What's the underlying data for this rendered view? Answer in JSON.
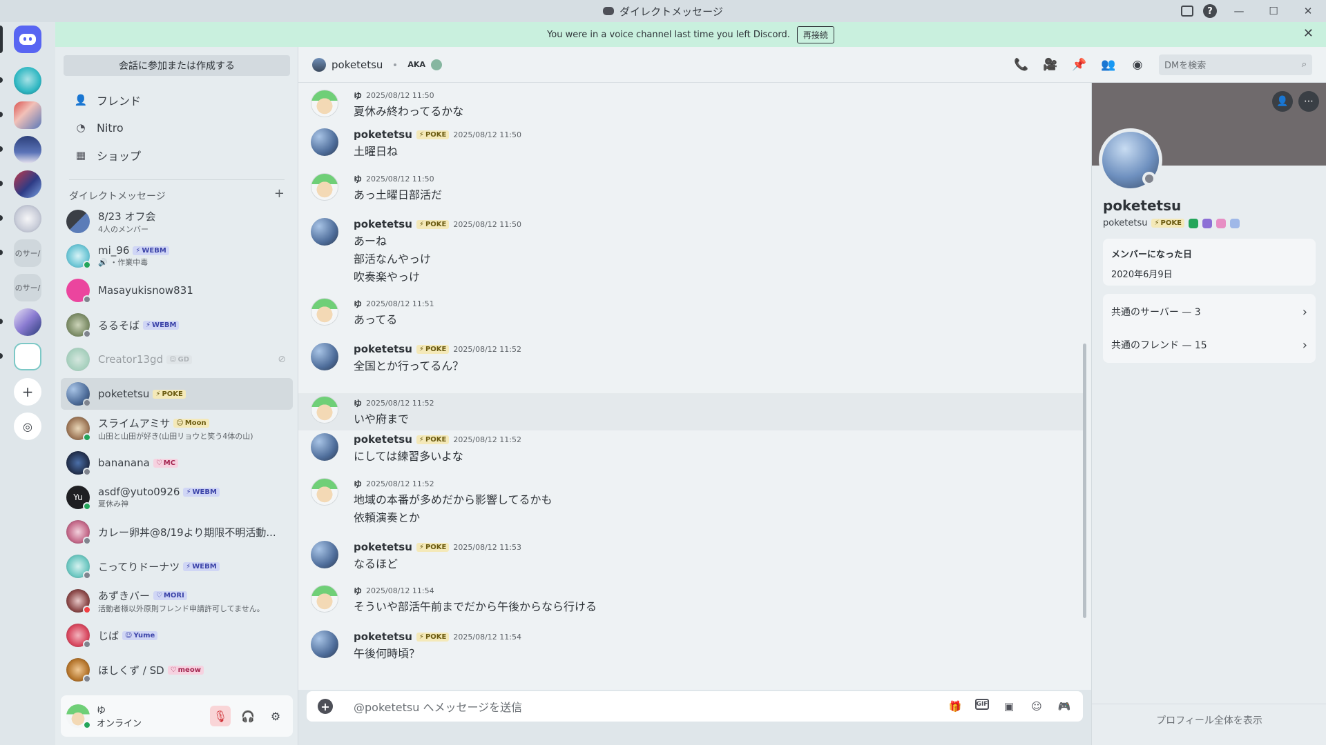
{
  "window": {
    "title": "ダイレクトメッセージ"
  },
  "banner": {
    "text": "You were in a voice channel last time you left Discord.",
    "reconnect": "再接続"
  },
  "sidebar": {
    "find_button": "会話に参加または作成する",
    "nav": [
      {
        "label": "フレンド",
        "icon": "friends-icon"
      },
      {
        "label": "Nitro",
        "icon": "nitro-icon"
      },
      {
        "label": "ショップ",
        "icon": "shop-icon"
      }
    ],
    "dm_header": "ダイレクトメッセージ",
    "dms": [
      {
        "name": "8/23 オフ会",
        "sub": "4人のメンバー",
        "tag": "",
        "status": "none"
      },
      {
        "name": "mi_96",
        "sub": "・作業中毒",
        "tag": "WEBM",
        "status": "on"
      },
      {
        "name": "Masayukisnow831",
        "sub": "",
        "tag": "",
        "status": "off"
      },
      {
        "name": "るるそば",
        "sub": "",
        "tag": "WEBM",
        "status": "off"
      },
      {
        "name": "Creator13gd",
        "sub": "",
        "tag": "GD",
        "status": "off"
      },
      {
        "name": "poketetsu",
        "sub": "",
        "tag": "POKE",
        "status": "off"
      },
      {
        "name": "スライムアミサ",
        "sub": "山田と山田が好き(山田リョウと笑う4体の山)",
        "tag": "Moon",
        "status": "on"
      },
      {
        "name": "bananana",
        "sub": "",
        "tag": "MC",
        "status": "off"
      },
      {
        "name": "asdf@yuto0926",
        "sub": "夏休み神",
        "tag": "WEBM",
        "status": "on"
      },
      {
        "name": "カレー卵丼@8/19より期限不明活動...",
        "sub": "",
        "tag": "",
        "status": "off"
      },
      {
        "name": "こってりドーナツ",
        "sub": "",
        "tag": "WEBM",
        "status": "off"
      },
      {
        "name": "あずきバー",
        "sub": "活動者様以外原則フレンド申請許可してません。",
        "tag": "MORI",
        "status": "dnd"
      },
      {
        "name": "じば",
        "sub": "",
        "tag": "Yume",
        "status": "off"
      },
      {
        "name": "ほしくず / SD",
        "sub": "",
        "tag": "meow",
        "status": "off"
      }
    ],
    "user": {
      "name": "ゆ",
      "status": "オンライン"
    }
  },
  "chat_header": {
    "name": "poketetsu",
    "aka": "AKA",
    "search_placeholder": "DMを検索"
  },
  "messages": [
    {
      "author": "ゆ",
      "tag": "",
      "time": "2025/08/12 11:50",
      "lines": [
        "夏休み終わってるかな"
      ]
    },
    {
      "author": "poketetsu",
      "tag": "POKE",
      "time": "2025/08/12 11:50",
      "lines": [
        "土曜日ね"
      ]
    },
    {
      "author": "ゆ",
      "tag": "",
      "time": "2025/08/12 11:50",
      "lines": [
        "あっ土曜日部活だ"
      ]
    },
    {
      "author": "poketetsu",
      "tag": "POKE",
      "time": "2025/08/12 11:50",
      "lines": [
        "あーね",
        "部活なんやっけ",
        "吹奏楽やっけ"
      ]
    },
    {
      "author": "ゆ",
      "tag": "",
      "time": "2025/08/12 11:51",
      "lines": [
        "あってる"
      ]
    },
    {
      "author": "poketetsu",
      "tag": "POKE",
      "time": "2025/08/12 11:52",
      "lines": [
        "全国とか行ってるん？"
      ]
    },
    {
      "author": "ゆ",
      "tag": "",
      "time": "2025/08/12 11:52",
      "lines": [
        "いや府まで"
      ]
    },
    {
      "author": "poketetsu",
      "tag": "POKE",
      "time": "2025/08/12 11:52",
      "lines": [
        "にしては練習多いよな"
      ]
    },
    {
      "author": "ゆ",
      "tag": "",
      "time": "2025/08/12 11:52",
      "lines": [
        "地域の本番が多めだから影響してるかも",
        "依頼演奏とか"
      ]
    },
    {
      "author": "poketetsu",
      "tag": "POKE",
      "time": "2025/08/12 11:53",
      "lines": [
        "なるほど"
      ]
    },
    {
      "author": "ゆ",
      "tag": "",
      "time": "2025/08/12 11:54",
      "lines": [
        "そういや部活午前までだから午後からなら行ける"
      ]
    },
    {
      "author": "poketetsu",
      "tag": "POKE",
      "time": "2025/08/12 11:54",
      "lines": [
        "午後何時頃？"
      ]
    }
  ],
  "composer": {
    "placeholder": "@poketetsu へメッセージを送信"
  },
  "profile": {
    "display_name": "poketetsu",
    "username": "poketetsu",
    "tag": "POKE",
    "member_since_label": "メンバーになった日",
    "member_since": "2020年6月9日",
    "mutual_servers": "共通のサーバー — 3",
    "mutual_friends": "共通のフレンド — 15",
    "view_full": "プロフィール全体を表示"
  },
  "colors": {
    "accent": "#5865f2",
    "online": "#23a55a",
    "dnd": "#f23f43",
    "banner": "#c9f0de"
  }
}
